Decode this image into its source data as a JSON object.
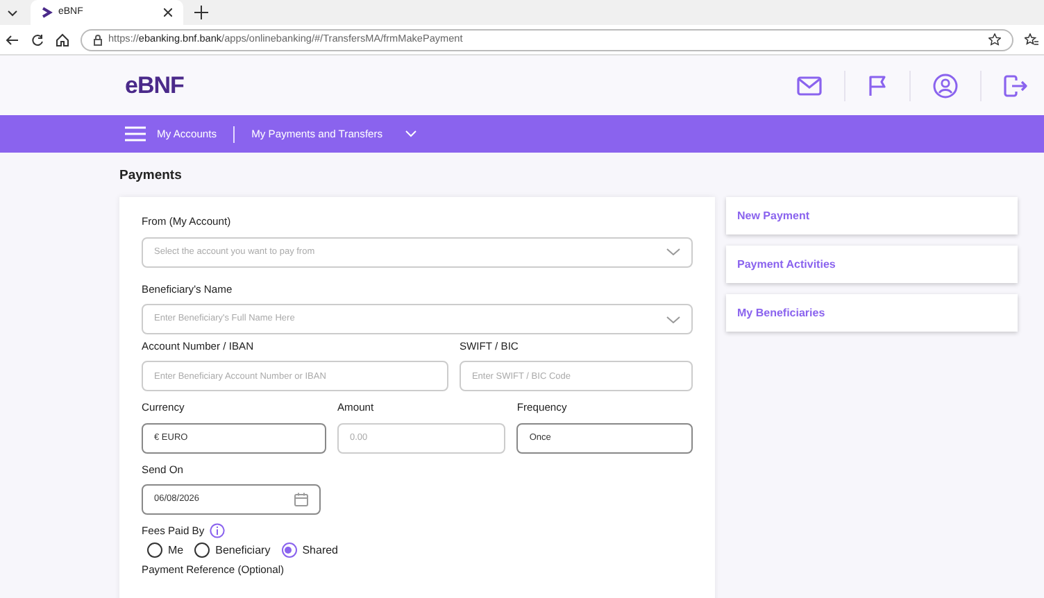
{
  "browser": {
    "tab_title": "eBNF",
    "url": "https://**ebanking.bnf.bank**/apps/onlinebanking/#/TransfersMA/frmMakePayment"
  },
  "header": {
    "logo": "eBNF"
  },
  "nav": {
    "items": [
      {
        "label": "My Accounts",
        "caret": false
      },
      {
        "label": "My Payments and Transfers",
        "caret": true
      }
    ]
  },
  "page_title": "Payments",
  "form": {
    "from_account": {
      "label": "From (My Account)",
      "kind": "select",
      "placeholder": "Select the account you want to pay from"
    },
    "beneficiary_name": {
      "label": "Beneficiary's Name",
      "kind": "select",
      "placeholder": "Enter Beneficiary's Full Name Here"
    },
    "account_number": {
      "label": "Account Number / IBAN",
      "kind": "input",
      "placeholder": "Enter Beneficiary Account Number or IBAN"
    },
    "swift": {
      "label": "SWIFT / BIC",
      "kind": "input",
      "placeholder": "Enter SWIFT / BIC Code"
    },
    "currency": {
      "label": "Currency",
      "kind": "input",
      "value": "€ EURO"
    },
    "amount": {
      "label": "Amount",
      "kind": "input",
      "placeholder": "0.00"
    },
    "frequency": {
      "label": "Frequency",
      "kind": "input",
      "value": "Once"
    },
    "send_on": {
      "label": "Send On",
      "kind": "date",
      "value": "06/08/2026"
    },
    "fees": {
      "label": "Fees Paid By",
      "options": [
        {
          "label": "Me",
          "selected": false
        },
        {
          "label": "Beneficiary",
          "selected": false
        },
        {
          "label": "Shared",
          "selected": true
        }
      ]
    },
    "reference_label": "Payment Reference (Optional)"
  },
  "side_links": [
    "New Payment",
    "Payment Activities",
    "My Beneficiaries"
  ]
}
